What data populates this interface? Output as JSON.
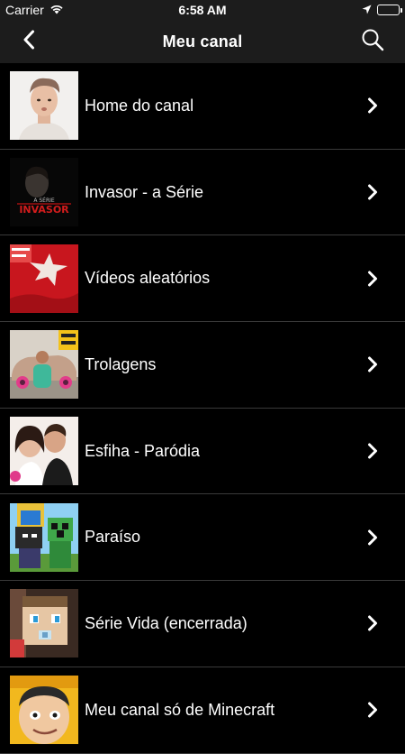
{
  "status": {
    "carrier": "Carrier",
    "time": "6:58 AM"
  },
  "nav": {
    "title": "Meu canal"
  },
  "thumbs": {
    "invasor_text": "INVASOR",
    "invasor_small": "A SÉRIE"
  },
  "items": [
    {
      "label": "Home do canal"
    },
    {
      "label": "Invasor - a Série"
    },
    {
      "label": "Vídeos aleatórios"
    },
    {
      "label": "Trolagens"
    },
    {
      "label": "Esfiha - Paródia"
    },
    {
      "label": "Paraíso"
    },
    {
      "label": "Série Vida (encerrada)"
    },
    {
      "label": "Meu canal só de Minecraft"
    }
  ]
}
